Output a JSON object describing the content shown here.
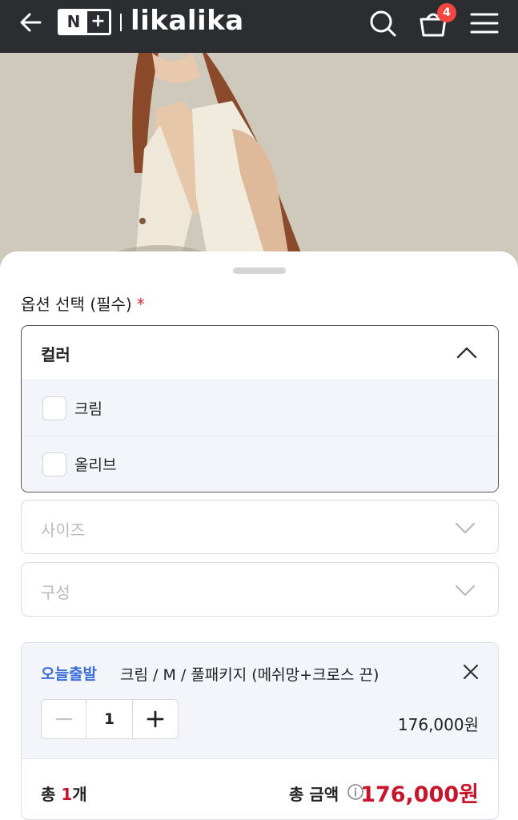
{
  "header": {
    "brand_badge_letter": "N",
    "brand_badge_plus": "+",
    "brand_name": "likalika",
    "cart_count": "4",
    "icons": [
      "back-arrow-icon",
      "search-icon",
      "shopping-bag-icon",
      "hamburger-menu-icon"
    ]
  },
  "option_panel": {
    "title": "옵션 선택 (필수)",
    "required_mark": "*",
    "color_dropdown": {
      "label": "컬러",
      "expanded": true,
      "options": [
        {
          "label": "크림",
          "checked": false
        },
        {
          "label": "올리브",
          "checked": false
        }
      ]
    },
    "size_select": {
      "placeholder": "사이즈"
    },
    "composition_select": {
      "placeholder": "구성"
    }
  },
  "selected_item": {
    "shipping_tag": "오늘출발",
    "name": "크림 / M / 풀패키지 (메쉬망+크로스 끈)",
    "quantity": "1",
    "price": "176,000원"
  },
  "summary": {
    "count_prefix": "총 ",
    "count_value": "1",
    "count_suffix": "개",
    "total_label": "총 금액",
    "total_price": "176,000원"
  },
  "colors": {
    "header_bg": "#2b2d30",
    "accent_red": "#c8152c",
    "link_blue": "#3b6fd6",
    "badge_red": "#f2473f"
  }
}
